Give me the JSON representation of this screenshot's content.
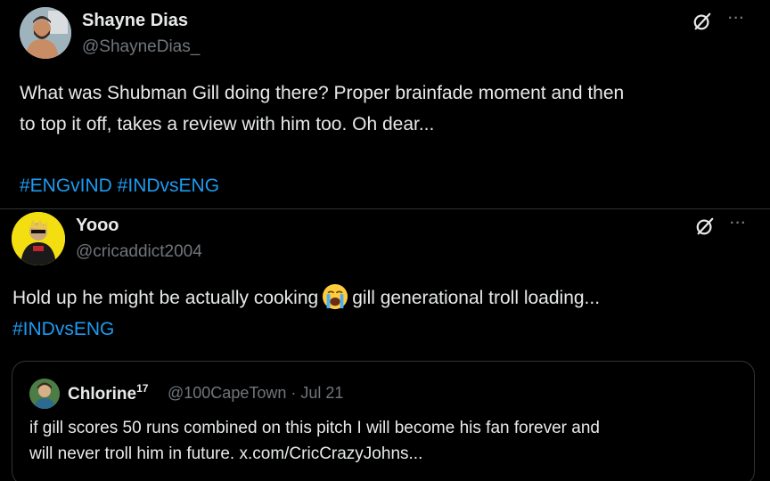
{
  "tweets": [
    {
      "author_name": "Shayne Dias",
      "author_handle": "@ShayneDias_",
      "text_line1": "What was Shubman Gill doing there? Proper brainfade moment and then",
      "text_line2": "to top it off, takes a review with him too. Oh dear...",
      "hashtags": "#ENGvIND #INDvsENG",
      "more_label": "···"
    },
    {
      "author_name": "Yooo",
      "author_handle": "@cricaddict2004",
      "text_before_emoji": "Hold up he might be actually cooking",
      "emoji": "loudly-crying-face",
      "text_after_emoji": "gill generational troll loading...",
      "hashtags": "#INDvsENG",
      "more_label": "···",
      "quoted": {
        "author_name": "Chlorine",
        "author_name_sup": "17",
        "meta": "@100CapeTown · Jul 21",
        "text_line1": "if gill scores 50 runs combined on this pitch I will become his fan forever and",
        "text_line2": "will never troll him in future. x.com/CricCrazyJohns..."
      }
    }
  ],
  "colors": {
    "background": "#000000",
    "text": "#e7e9ea",
    "secondary": "#71767b",
    "hashtag": "#1d9bf0",
    "border": "#2f3336"
  }
}
